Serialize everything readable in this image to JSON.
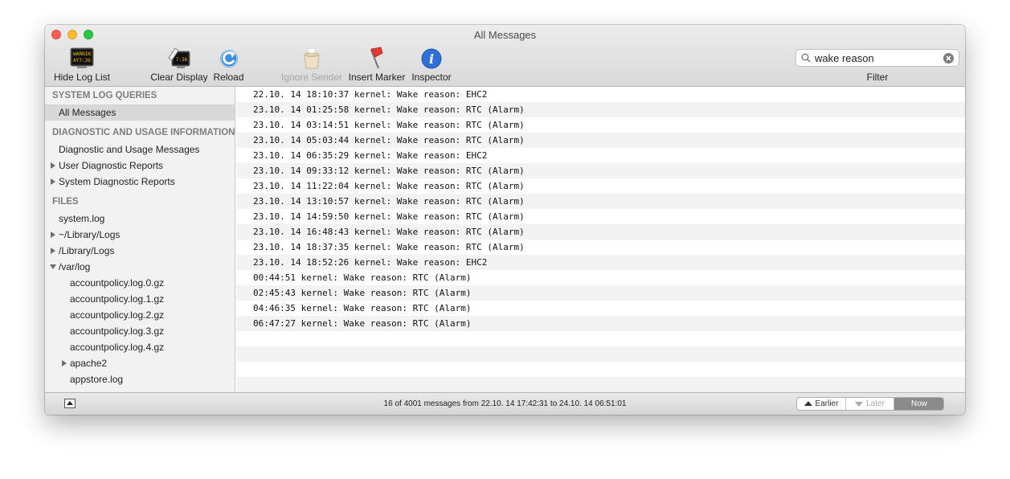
{
  "window": {
    "title": "All Messages"
  },
  "toolbar": {
    "hide_log_list": {
      "label": "Hide Log List",
      "icon": "console-log-icon"
    },
    "clear_display": {
      "label": "Clear Display",
      "icon": "clear-display-icon"
    },
    "reload": {
      "label": "Reload",
      "icon": "reload-icon"
    },
    "ignore_sender": {
      "label": "Ignore Sender",
      "icon": "ignore-sender-icon",
      "enabled": false
    },
    "insert_marker": {
      "label": "Insert Marker",
      "icon": "marker-flag-icon"
    },
    "inspector": {
      "label": "Inspector",
      "icon": "info-icon"
    },
    "search": {
      "value": "wake reason",
      "label": "Filter"
    }
  },
  "sidebar": {
    "queries_header": "SYSTEM LOG QUERIES",
    "all_messages": "All Messages",
    "diag_header": "DIAGNOSTIC AND USAGE INFORMATION",
    "diag_messages": "Diagnostic and Usage Messages",
    "user_reports": "User Diagnostic Reports",
    "system_reports": "System Diagnostic Reports",
    "files_header": "FILES",
    "system_log": "system.log",
    "user_library_logs": "~/Library/Logs",
    "library_logs": "/Library/Logs",
    "var_log": "/var/log",
    "var_log_children": [
      "accountpolicy.log.0.gz",
      "accountpolicy.log.1.gz",
      "accountpolicy.log.2.gz",
      "accountpolicy.log.3.gz",
      "accountpolicy.log.4.gz",
      "apache2",
      "appstore.log"
    ]
  },
  "log": {
    "lines": [
      "22.10. 14 18:10:37 kernel: Wake reason: EHC2",
      "23.10. 14 01:25:58 kernel: Wake reason: RTC (Alarm)",
      "23.10. 14 03:14:51 kernel: Wake reason: RTC (Alarm)",
      "23.10. 14 05:03:44 kernel: Wake reason: RTC (Alarm)",
      "23.10. 14 06:35:29 kernel: Wake reason: EHC2",
      "23.10. 14 09:33:12 kernel: Wake reason: RTC (Alarm)",
      "23.10. 14 11:22:04 kernel: Wake reason: RTC (Alarm)",
      "23.10. 14 13:10:57 kernel: Wake reason: RTC (Alarm)",
      "23.10. 14 14:59:50 kernel: Wake reason: RTC (Alarm)",
      "23.10. 14 16:48:43 kernel: Wake reason: RTC (Alarm)",
      "23.10. 14 18:37:35 kernel: Wake reason: RTC (Alarm)",
      "23.10. 14 18:52:26 kernel: Wake reason: EHC2",
      "00:44:51 kernel: Wake reason: RTC (Alarm)",
      "02:45:43 kernel: Wake reason: RTC (Alarm)",
      "04:46:35 kernel: Wake reason: RTC (Alarm)",
      "06:47:27 kernel: Wake reason: RTC (Alarm)",
      "",
      "",
      "",
      ""
    ]
  },
  "status": {
    "text": "16 of 4001 messages from 22.10. 14 17:42:31 to 24.10. 14 06:51:01",
    "earlier": "Earlier",
    "later": "Later",
    "now": "Now"
  },
  "colors": {
    "close": "#fc5f57",
    "minimize": "#fdbc2e",
    "zoom": "#28c840",
    "selection": "#d8d8d8",
    "inspector_blue": "#2f6fd6",
    "reload_blue": "#3a8fe0"
  }
}
